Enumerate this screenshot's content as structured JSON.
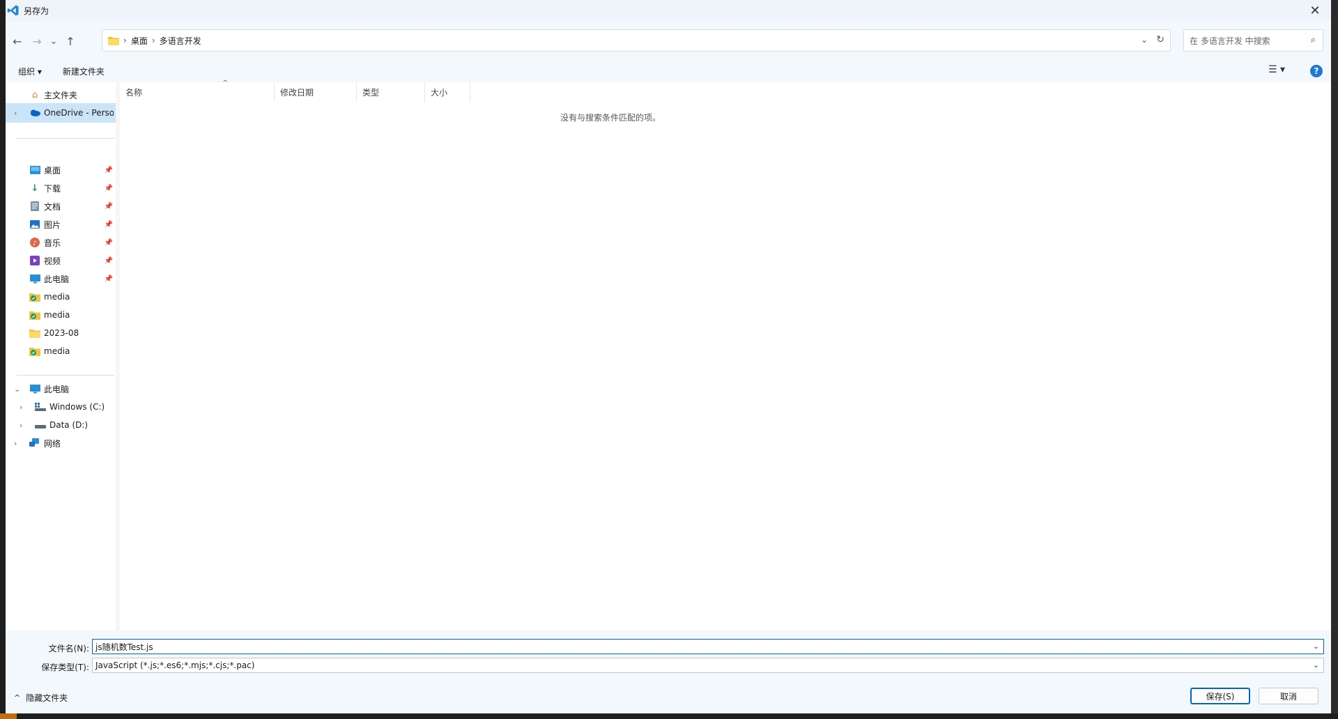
{
  "window": {
    "title": "另存为",
    "close_glyph": "✕"
  },
  "nav": {
    "back_icon": "←",
    "forward_icon": "→",
    "recent_icon": "⌄",
    "up_icon": "↑",
    "breadcrumbs": [
      "桌面",
      "多语言开发"
    ],
    "search_placeholder": "在 多语言开发 中搜索"
  },
  "commands": {
    "organize": "组织 ▾",
    "new_folder": "新建文件夹"
  },
  "sidebar": {
    "items": [
      {
        "label": "主文件夹",
        "icon": "home-icon"
      },
      {
        "label": "OneDrive - Perso",
        "icon": "onedrive-icon"
      },
      {
        "label": "桌面",
        "icon": "desktop-icon"
      },
      {
        "label": "下载",
        "icon": "download-icon"
      },
      {
        "label": "文档",
        "icon": "document-icon"
      },
      {
        "label": "图片",
        "icon": "pictures-icon"
      },
      {
        "label": "音乐",
        "icon": "music-icon"
      },
      {
        "label": "视频",
        "icon": "video-icon"
      },
      {
        "label": "此电脑",
        "icon": "pc-icon"
      },
      {
        "label": "media",
        "icon": "folder-icon"
      },
      {
        "label": "media",
        "icon": "folder-icon"
      },
      {
        "label": "2023-08",
        "icon": "folder-icon"
      },
      {
        "label": "media",
        "icon": "folder-icon"
      },
      {
        "label": "此电脑",
        "icon": "pc-icon"
      },
      {
        "label": "Windows (C:)",
        "icon": "drive-icon"
      },
      {
        "label": "Data (D:)",
        "icon": "drive-icon"
      },
      {
        "label": "网络",
        "icon": "network-icon"
      }
    ]
  },
  "columns": [
    "名称",
    "修改日期",
    "类型",
    "大小"
  ],
  "empty_message": "没有与搜索条件匹配的项。",
  "bottom": {
    "filename_label": "文件名(N):",
    "filename_value": "js随机数Test.js",
    "filetype_label": "保存类型(T):",
    "filetype_value": "JavaScript (*.js;*.es6;*.mjs;*.cjs;*.pac)",
    "hide_folders": "隐藏文件夹",
    "save_label": "保存(S)",
    "cancel_label": "取消"
  },
  "colors": {
    "accent": "#0067c0",
    "selection": "#cce4f7",
    "chrome": "#f3f8fc"
  }
}
